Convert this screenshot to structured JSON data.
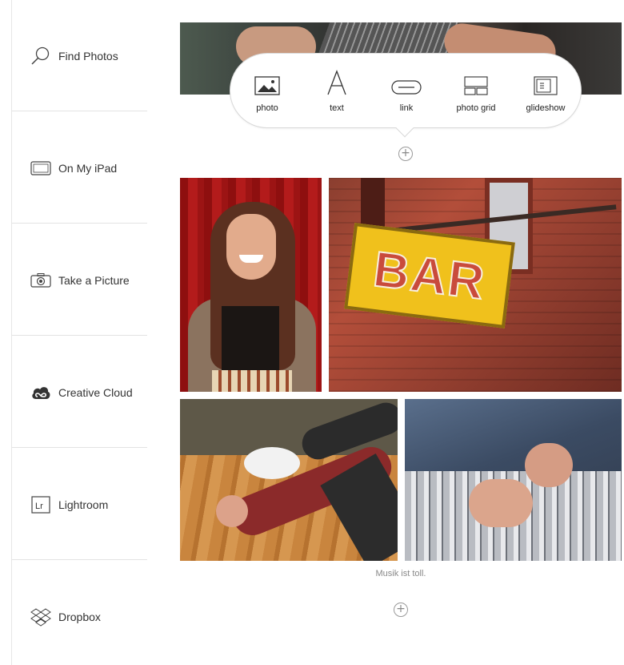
{
  "sidebar": {
    "items": [
      {
        "label": "Find Photos",
        "icon": "search-icon"
      },
      {
        "label": "On My iPad",
        "icon": "ipad-icon"
      },
      {
        "label": "Take a Picture",
        "icon": "camera-icon"
      },
      {
        "label": "Creative Cloud",
        "icon": "creative-cloud-icon"
      },
      {
        "label": "Lightroom",
        "icon": "lightroom-icon"
      },
      {
        "label": "Dropbox",
        "icon": "dropbox-icon"
      }
    ]
  },
  "toolbar": {
    "items": [
      {
        "label": "photo",
        "icon": "photo-icon"
      },
      {
        "label": "text",
        "icon": "text-icon"
      },
      {
        "label": "link",
        "icon": "link-icon"
      },
      {
        "label": "photo grid",
        "icon": "photo-grid-icon"
      },
      {
        "label": "glideshow",
        "icon": "glideshow-icon"
      }
    ]
  },
  "content": {
    "bar_sign_text": "BAR",
    "caption": "Musik ist toll.",
    "add_symbol": "+"
  },
  "colors": {
    "accent": "#f0c11c",
    "divider": "#e3e3e3"
  }
}
